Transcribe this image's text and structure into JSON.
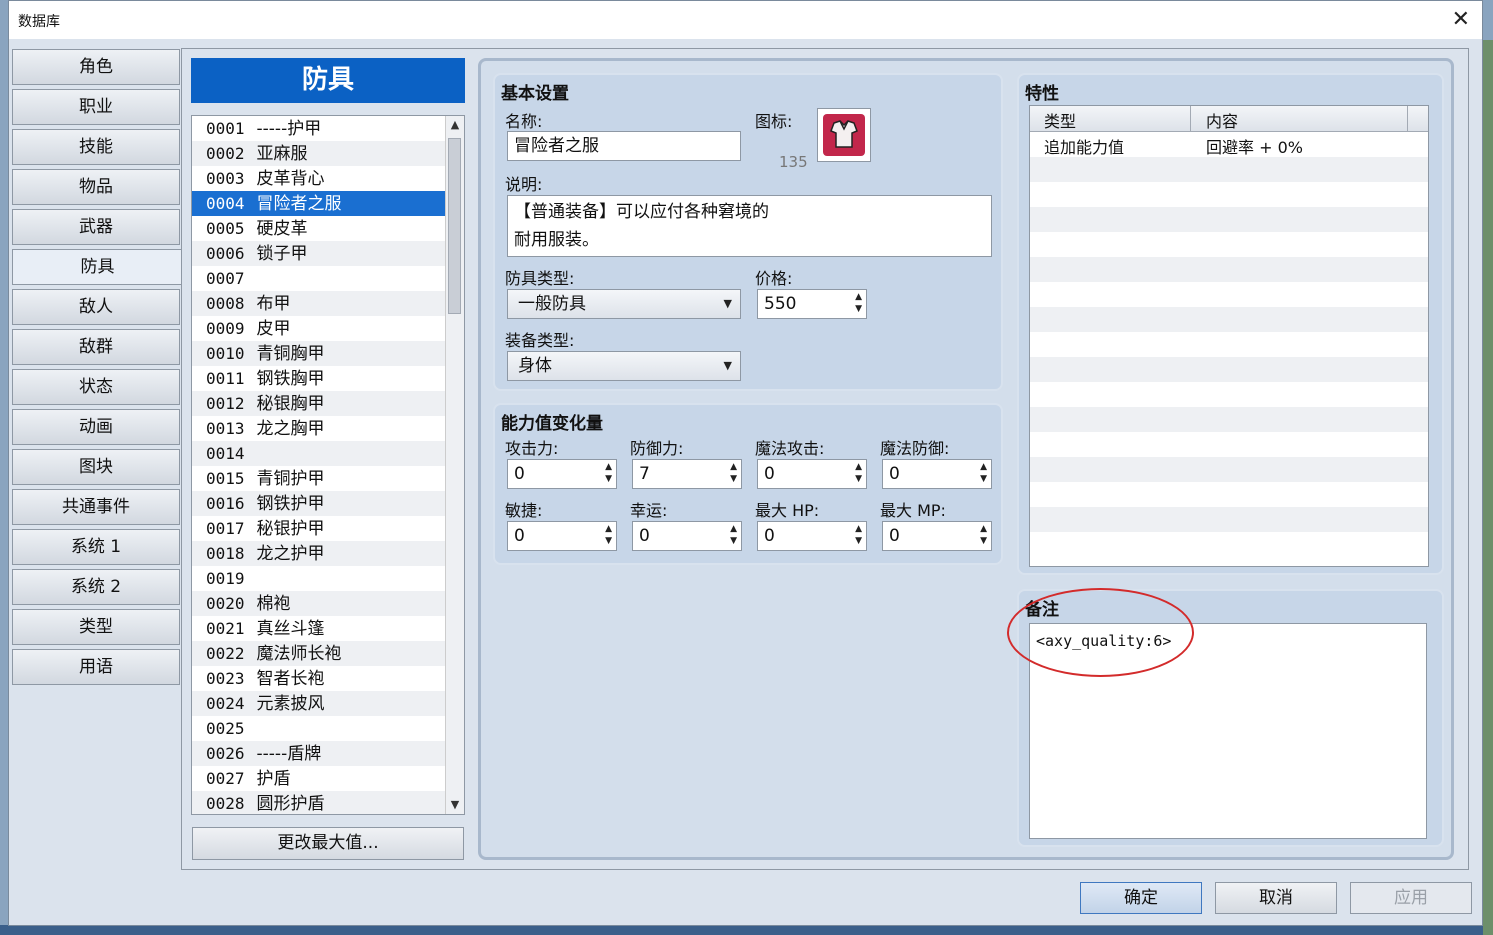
{
  "window": {
    "title": "数据库",
    "close_glyph": "✕"
  },
  "categories": [
    "角色",
    "职业",
    "技能",
    "物品",
    "武器",
    "防具",
    "敌人",
    "敌群",
    "状态",
    "动画",
    "图块",
    "共通事件",
    "系统 1",
    "系统 2",
    "类型",
    "用语"
  ],
  "active_category": "防具",
  "list": {
    "header": "防具",
    "items": [
      {
        "num": "0001",
        "name": "-----护甲"
      },
      {
        "num": "0002",
        "name": "亚麻服"
      },
      {
        "num": "0003",
        "name": "皮革背心"
      },
      {
        "num": "0004",
        "name": "冒险者之服"
      },
      {
        "num": "0005",
        "name": "硬皮革"
      },
      {
        "num": "0006",
        "name": "锁子甲"
      },
      {
        "num": "0007",
        "name": ""
      },
      {
        "num": "0008",
        "name": "布甲"
      },
      {
        "num": "0009",
        "name": "皮甲"
      },
      {
        "num": "0010",
        "name": "青铜胸甲"
      },
      {
        "num": "0011",
        "name": "钢铁胸甲"
      },
      {
        "num": "0012",
        "name": "秘银胸甲"
      },
      {
        "num": "0013",
        "name": "龙之胸甲"
      },
      {
        "num": "0014",
        "name": ""
      },
      {
        "num": "0015",
        "name": "青铜护甲"
      },
      {
        "num": "0016",
        "name": "钢铁护甲"
      },
      {
        "num": "0017",
        "name": "秘银护甲"
      },
      {
        "num": "0018",
        "name": "龙之护甲"
      },
      {
        "num": "0019",
        "name": ""
      },
      {
        "num": "0020",
        "name": "棉袍"
      },
      {
        "num": "0021",
        "name": "真丝斗篷"
      },
      {
        "num": "0022",
        "name": "魔法师长袍"
      },
      {
        "num": "0023",
        "name": "智者长袍"
      },
      {
        "num": "0024",
        "name": "元素披风"
      },
      {
        "num": "0025",
        "name": ""
      },
      {
        "num": "0026",
        "name": "-----盾牌"
      },
      {
        "num": "0027",
        "name": "护盾"
      },
      {
        "num": "0028",
        "name": "圆形护盾"
      }
    ],
    "selected_index": 3,
    "change_max_label": "更改最大值..."
  },
  "basic": {
    "title": "基本设置",
    "name_label": "名称:",
    "name_value": "冒险者之服",
    "icon_label": "图标:",
    "icon_index": "135",
    "desc_label": "说明:",
    "desc_line1": "【普通装备】可以应付各种窘境的",
    "desc_line2": "耐用服装。",
    "armor_type_label": "防具类型:",
    "armor_type_value": "一般防具",
    "price_label": "价格:",
    "price_value": "550",
    "equip_type_label": "装备类型:",
    "equip_type_value": "身体"
  },
  "params": {
    "title": "能力值变化量",
    "atk_label": "攻击力:",
    "atk": "0",
    "def_label": "防御力:",
    "def": "7",
    "mat_label": "魔法攻击:",
    "mat": "0",
    "mdf_label": "魔法防御:",
    "mdf": "0",
    "agi_label": "敏捷:",
    "agi": "0",
    "luk_label": "幸运:",
    "luk": "0",
    "mhp_label": "最大 HP:",
    "mhp": "0",
    "mmp_label": "最大 MP:",
    "mmp": "0"
  },
  "traits": {
    "title": "特性",
    "col_type": "类型",
    "col_content": "内容",
    "row1_type": "追加能力值",
    "row1_content": "回避率 + 0%"
  },
  "note": {
    "title": "备注",
    "text": "<axy_quality:6>"
  },
  "footer": {
    "ok": "确定",
    "cancel": "取消",
    "apply": "应用"
  },
  "colors": {
    "selected": "#1a6fd1",
    "header_blue": "#0b61c4",
    "annotation_red": "#d32b2b"
  }
}
